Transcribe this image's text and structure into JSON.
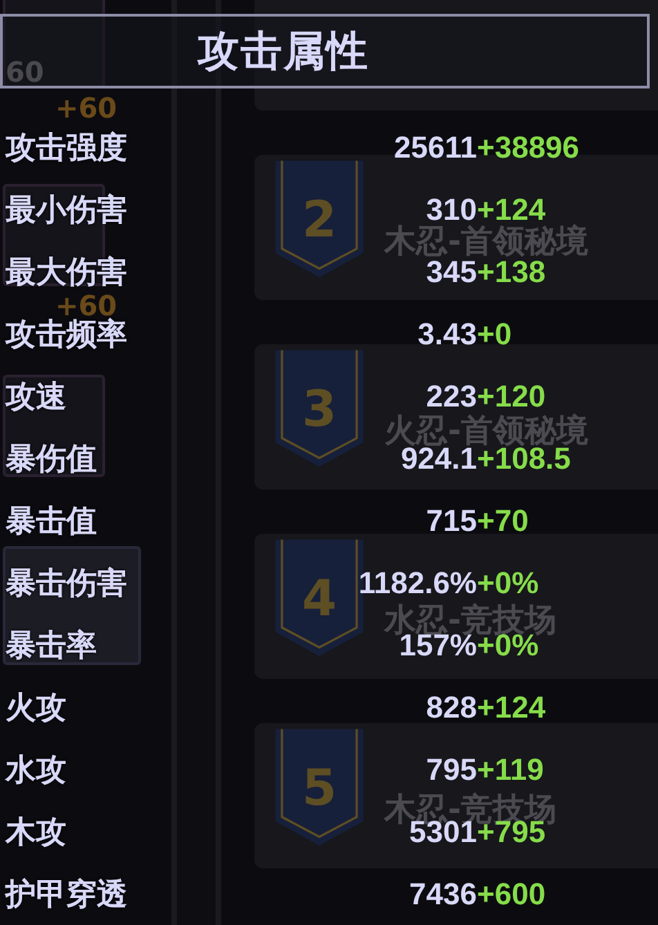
{
  "background": {
    "tiles": [
      {
        "kind": "skill",
        "level": "60",
        "bonus": "+60"
      },
      {
        "kind": "skill",
        "bonus": "+60"
      },
      {
        "kind": "skill"
      },
      {
        "kind": "talent"
      }
    ],
    "cards": [
      {
        "kind": "plain"
      },
      {
        "badge": "2",
        "title": "木忍-首领秘境"
      },
      {
        "badge": "3",
        "title": "火忍-首领秘境"
      },
      {
        "badge": "4",
        "title": "水忍-竞技场"
      },
      {
        "badge": "5",
        "title": "木忍-竞技场"
      }
    ]
  },
  "panel": {
    "title": "攻击属性",
    "stats": [
      {
        "label": "攻击强度",
        "base": "25611",
        "bonus": "+38896"
      },
      {
        "label": "最小伤害",
        "base": "310",
        "bonus": "+124"
      },
      {
        "label": "最大伤害",
        "base": "345",
        "bonus": "+138"
      },
      {
        "label": "攻击频率",
        "base": "3.43",
        "bonus": "+0"
      },
      {
        "label": "攻速",
        "base": "223",
        "bonus": "+120"
      },
      {
        "label": "暴伤值",
        "base": "924.1",
        "bonus": "+108.5"
      },
      {
        "label": "暴击值",
        "base": "715",
        "bonus": "+70"
      },
      {
        "label": "暴击伤害",
        "base": "1182.6%",
        "bonus": "+0%"
      },
      {
        "label": "暴击率",
        "base": "157%",
        "bonus": "+0%"
      },
      {
        "label": "火攻",
        "base": "828",
        "bonus": "+124"
      },
      {
        "label": "水攻",
        "base": "795",
        "bonus": "+119"
      },
      {
        "label": "木攻",
        "base": "5301",
        "bonus": "+795"
      },
      {
        "label": "护甲穿透",
        "base": "7436",
        "bonus": "+600"
      }
    ]
  }
}
